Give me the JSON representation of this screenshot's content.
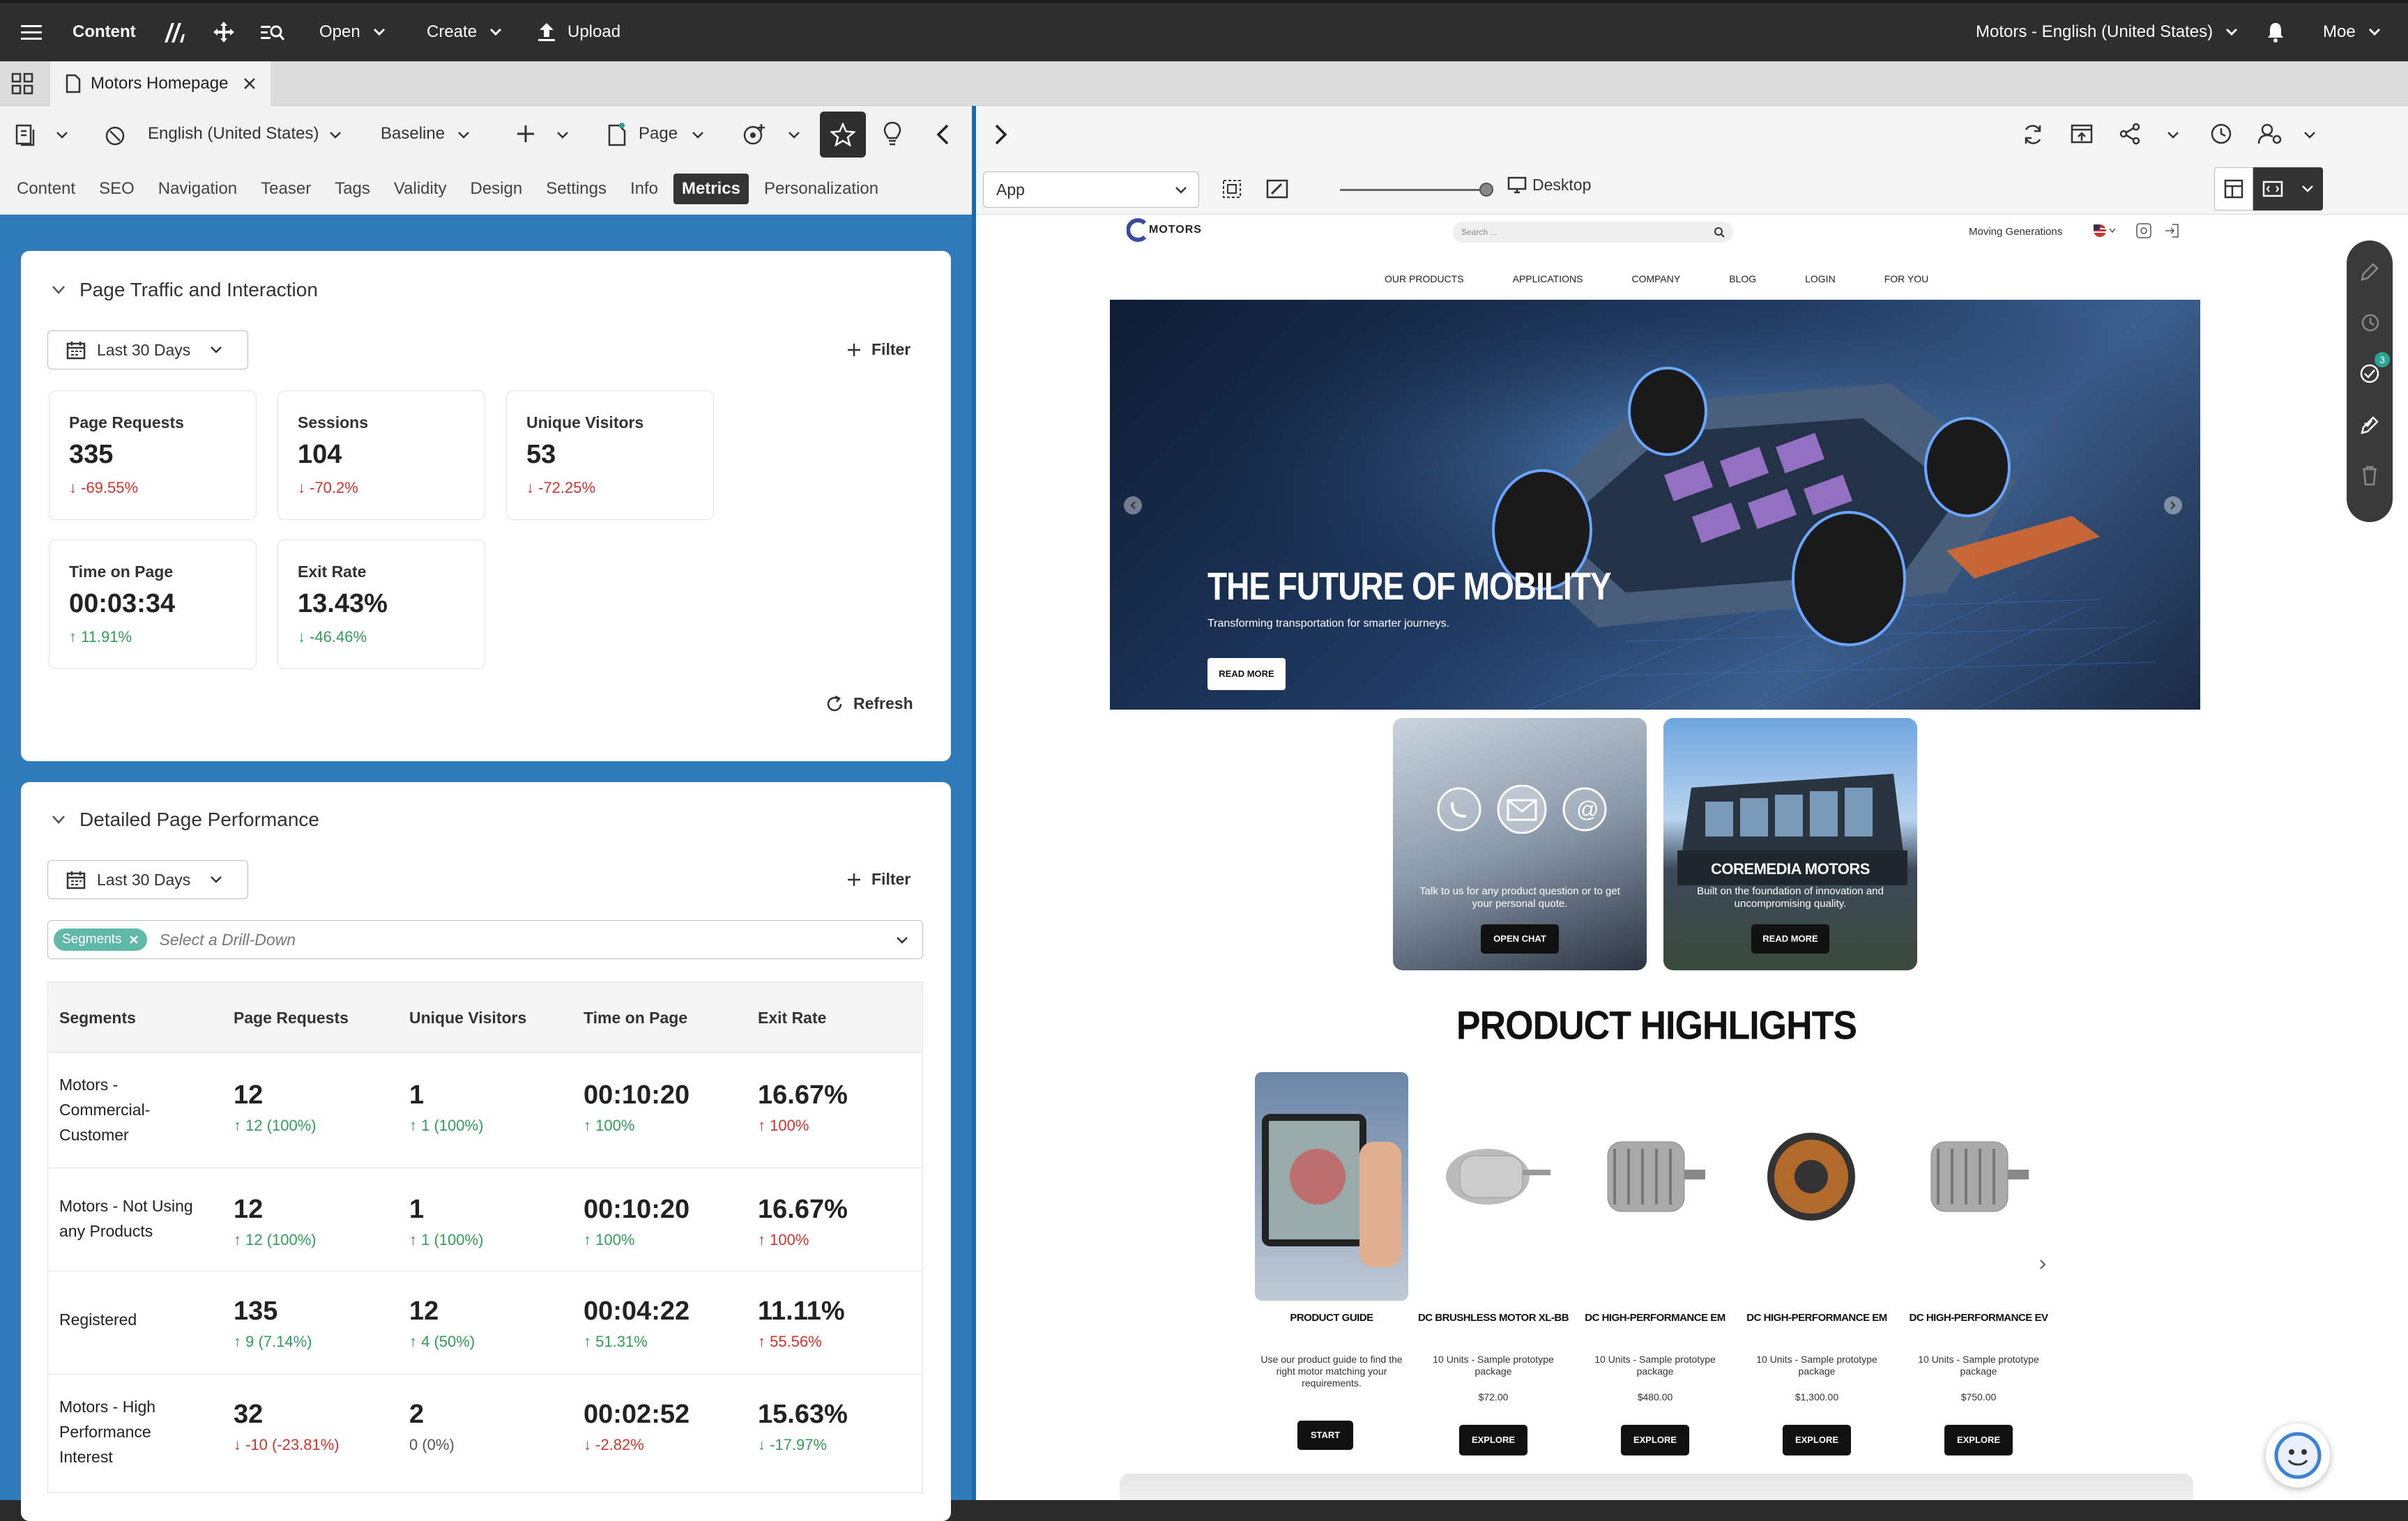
{
  "topbar": {
    "app_label": "Content",
    "open_label": "Open",
    "create_label": "Create",
    "upload_label": "Upload",
    "site_label": "Motors - English (United States)",
    "user_label": "Moe"
  },
  "tabbar": {
    "tab_title": "Motors Homepage"
  },
  "toolbar": {
    "locale": "English (United States)",
    "variant": "Baseline",
    "page_label": "Page"
  },
  "subtabs": [
    "Content",
    "SEO",
    "Navigation",
    "Teaser",
    "Tags",
    "Validity",
    "Design",
    "Settings",
    "Info",
    "Metrics",
    "Personalization"
  ],
  "traffic": {
    "title": "Page Traffic and Interaction",
    "range": "Last 30 Days",
    "filter": "Filter",
    "refresh": "Refresh",
    "kpis": [
      {
        "label": "Page Requests",
        "value": "335",
        "delta": "-69.55%"
      },
      {
        "label": "Sessions",
        "value": "104",
        "delta": "-70.2%"
      },
      {
        "label": "Unique Visitors",
        "value": "53",
        "delta": "-72.25%"
      },
      {
        "label": "Time on Page",
        "value": "00:03:34",
        "delta": "11.91%"
      },
      {
        "label": "Exit Rate",
        "value": "13.43%",
        "delta": "-46.46%"
      }
    ]
  },
  "detail": {
    "title": "Detailed Page Performance",
    "range": "Last 30 Days",
    "filter": "Filter",
    "chip": "Segments",
    "drill_placeholder": "Select a Drill-Down",
    "columns": [
      "Segments",
      "Page Requests",
      "Unique Visitors",
      "Time on Page",
      "Exit Rate"
    ],
    "rows": [
      {
        "seg1": "Motors -",
        "seg2": "Commercial-",
        "seg3": "Customer",
        "pr": "12",
        "prd": "12 (100%)",
        "uv": "1",
        "uvd": "1 (100%)",
        "tp": "00:10:20",
        "tpd": "100%",
        "er": "16.67%",
        "erd": "100%"
      },
      {
        "seg1": "Motors - Not Using",
        "seg2": "any Products",
        "seg3": "",
        "pr": "12",
        "prd": "12 (100%)",
        "uv": "1",
        "uvd": "1 (100%)",
        "tp": "00:10:20",
        "tpd": "100%",
        "er": "16.67%",
        "erd": "100%"
      },
      {
        "seg1": "Registered",
        "seg2": "",
        "seg3": "",
        "pr": "135",
        "prd": "9 (7.14%)",
        "uv": "12",
        "uvd": "4 (50%)",
        "tp": "00:04:22",
        "tpd": "51.31%",
        "er": "11.11%",
        "erd": "55.56%"
      },
      {
        "seg1": "Motors - High",
        "seg2": "Performance",
        "seg3": "Interest",
        "pr": "32",
        "prd": "-10 (-23.81%)",
        "uv": "2",
        "uvd": "0 (0%)",
        "tp": "00:02:52",
        "tpd": "-2.82%",
        "er": "15.63%",
        "erd": "-17.97%"
      }
    ]
  },
  "preview_toolbar": {
    "app_select": "App",
    "device": "Desktop"
  },
  "site": {
    "logo": "MOTORS",
    "search_placeholder": "Search ...",
    "tagline": "Moving Generations",
    "nav": [
      "OUR PRODUCTS",
      "APPLICATIONS",
      "COMPANY",
      "BLOG",
      "LOGIN",
      "FOR YOU"
    ],
    "hero_title": "THE FUTURE OF MOBILITY",
    "hero_sub": "Transforming transportation for smarter journeys.",
    "hero_btn": "READ MORE",
    "tile1_text": "Talk to us for any product question or to get your personal quote.",
    "tile1_btn": "OPEN CHAT",
    "tile2_title": "COREMEDIA MOTORS",
    "tile2_text": "Built on the foundation of innovation and uncompromising quality.",
    "tile2_btn": "READ MORE",
    "highlights_title": "PRODUCT HIGHLIGHTS",
    "products": [
      {
        "name": "PRODUCT GUIDE",
        "desc": "Use our product guide to find the right motor matching your requirements.",
        "price": "",
        "btn": "START"
      },
      {
        "name": "DC BRUSHLESS MOTOR XL-BB",
        "desc": "10 Units - Sample prototype package",
        "price": "$72.00",
        "btn": "EXPLORE"
      },
      {
        "name": "DC HIGH-PERFORMANCE EM",
        "desc": "10 Units - Sample prototype package",
        "price": "$480.00",
        "btn": "EXPLORE"
      },
      {
        "name": "DC HIGH-PERFORMANCE EM",
        "desc": "10 Units - Sample prototype package",
        "price": "$1,300.00",
        "btn": "EXPLORE"
      },
      {
        "name": "DC HIGH-PERFORMANCE EV",
        "desc": "10 Units - Sample prototype package",
        "price": "$750.00",
        "btn": "EXPLORE"
      }
    ]
  },
  "side_badge": "3",
  "colors": {
    "accent": "#2f7ab8",
    "up": "#2f9e57",
    "down": "#d0342c",
    "chip": "#5fb8a8"
  }
}
